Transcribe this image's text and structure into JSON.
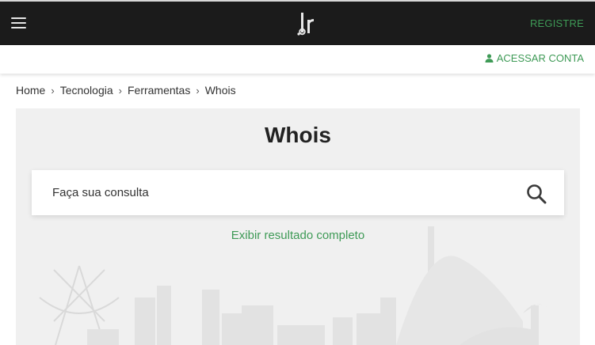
{
  "header": {
    "menu_icon": "hamburger-menu-icon",
    "logo_icon": "br-logo-icon",
    "register_label": "REGISTRE"
  },
  "subheader": {
    "account_icon": "user-icon",
    "account_label": "ACESSAR CONTA"
  },
  "breadcrumb": {
    "items": [
      "Home",
      "Tecnologia",
      "Ferramentas",
      "Whois"
    ],
    "separator": "›"
  },
  "main": {
    "title": "Whois",
    "search": {
      "placeholder": "Faça sua consulta",
      "value": "",
      "button_icon": "search-icon"
    },
    "full_result_label": "Exibir resultado completo"
  },
  "colors": {
    "accent": "#3e9a56",
    "navbar": "#1b1b1b",
    "panel": "#f0f0f0"
  }
}
